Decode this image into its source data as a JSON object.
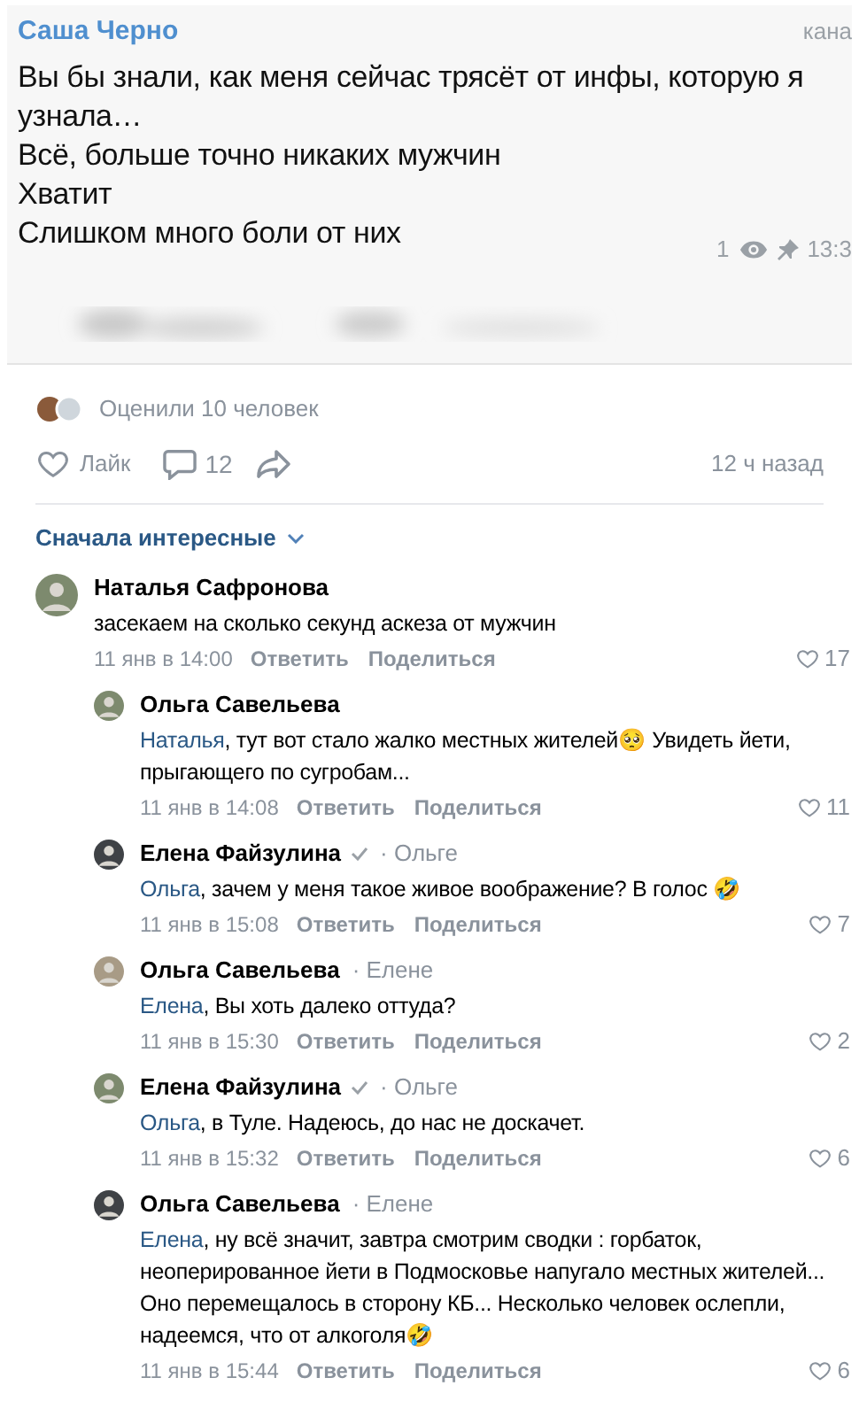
{
  "message": {
    "author": "Саша Черно",
    "channel": "кана",
    "lines": [
      "Вы бы знали, как меня сейчас трясёт от инфы, которую я узнала…",
      "Всё, больше точно никаких мужчин",
      "Хватит",
      "Слишком много боли от них"
    ],
    "views": "1",
    "time": "13:3"
  },
  "post": {
    "reactions": "Оценили 10 человек",
    "like_label": "Лайк",
    "comments_count": "12",
    "age": "12 ч назад"
  },
  "sort": {
    "label": "Сначала интересные"
  },
  "comments": [
    {
      "author": "Наталья Сафронова",
      "text": "засекаем на сколько секунд аскеза от мужчин",
      "date": "11 янв в 14:00",
      "reply": "Ответить",
      "share": "Поделиться",
      "likes": "17",
      "children": [
        {
          "author": "Ольга Савельева",
          "verified": false,
          "mention": "Наталья",
          "text": ", тут вот стало жалко местных жителей🥺 Увидеть йети, прыгающего по сугробам...",
          "date": "11 янв в 14:08",
          "reply": "Ответить",
          "share": "Поделиться",
          "likes": "11"
        },
        {
          "author": "Елена Файзулина",
          "verified": true,
          "to": "· Ольге",
          "mention": "Ольга",
          "text": ", зачем у меня такое живое воображение? В голос 🤣",
          "date": "11 янв в 15:08",
          "reply": "Ответить",
          "share": "Поделиться",
          "likes": "7"
        },
        {
          "author": "Ольга Савельева",
          "verified": false,
          "to": "· Елене",
          "mention": "Елена",
          "text": ", Вы хоть далеко оттуда?",
          "date": "11 янв в 15:30",
          "reply": "Ответить",
          "share": "Поделиться",
          "likes": "2"
        },
        {
          "author": "Елена Файзулина",
          "verified": true,
          "to": "· Ольге",
          "mention": "Ольга",
          "text": ", в Туле. Надеюсь, до нас не доскачет.",
          "date": "11 янв в 15:32",
          "reply": "Ответить",
          "share": "Поделиться",
          "likes": "6"
        },
        {
          "author": "Ольга Савельева",
          "verified": false,
          "to": "· Елене",
          "mention": "Елена",
          "text": ", ну всё значит, завтра смотрим сводки : горбаток, неоперированное йети в Подмосковье напугало местных жителей... Оно перемещалось в сторону КБ... Несколько человек ослепли, надеемся, что от алкоголя🤣",
          "date": "11 янв в 15:44",
          "reply": "Ответить",
          "share": "Поделиться",
          "likes": "6"
        }
      ]
    }
  ]
}
